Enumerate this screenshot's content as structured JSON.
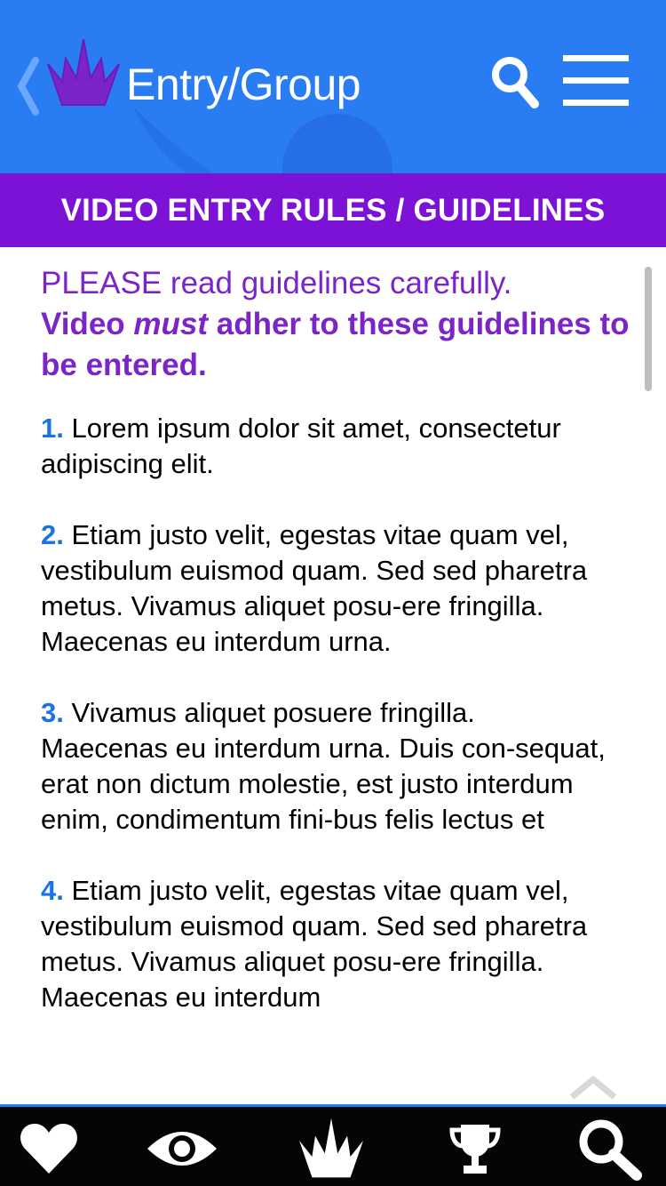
{
  "header": {
    "title": "Entry/Group"
  },
  "banner": {
    "title": "VIDEO ENTRY RULES / GUIDELINES"
  },
  "intro": {
    "line1": "PLEASE read guidelines carefully.",
    "line2_before": "Video ",
    "line2_em": "must",
    "line2_after": " adher to these guidelines to be entered."
  },
  "rules": [
    {
      "num": "1.",
      "text": "Lorem ipsum dolor sit amet, consectetur adipiscing elit."
    },
    {
      "num": "2.",
      "text": "Etiam justo velit, egestas vitae quam vel, vestibulum euismod quam. Sed sed pharetra metus. Vivamus aliquet posu-ere fringilla. Maecenas eu interdum urna."
    },
    {
      "num": "3.",
      "text": "Vivamus aliquet posuere fringilla. Maecenas eu interdum urna. Duis con-sequat, erat non dictum molestie, est justo interdum enim, condimentum fini-bus felis lectus et"
    },
    {
      "num": "4.",
      "text": "Etiam justo velit, egestas vitae quam vel, vestibulum euismod quam. Sed sed pharetra metus. Vivamus aliquet posu-ere fringilla. Maecenas eu interdum"
    }
  ],
  "icons": {
    "back": "chevron-left-icon",
    "logo": "crown-logo-icon",
    "search": "search-icon",
    "menu": "hamburger-menu-icon",
    "scroll_top": "chevron-up-icon",
    "nav": [
      "heart-icon",
      "eye-icon",
      "crown-logo-icon",
      "trophy-icon",
      "search-icon"
    ]
  },
  "colors": {
    "header_blue": "#2a7cf3",
    "banner_purple": "#7b12d6",
    "intro_purple": "#7b25c9",
    "rule_number_blue": "#1a73e3",
    "bottom_bar": "#050505"
  }
}
